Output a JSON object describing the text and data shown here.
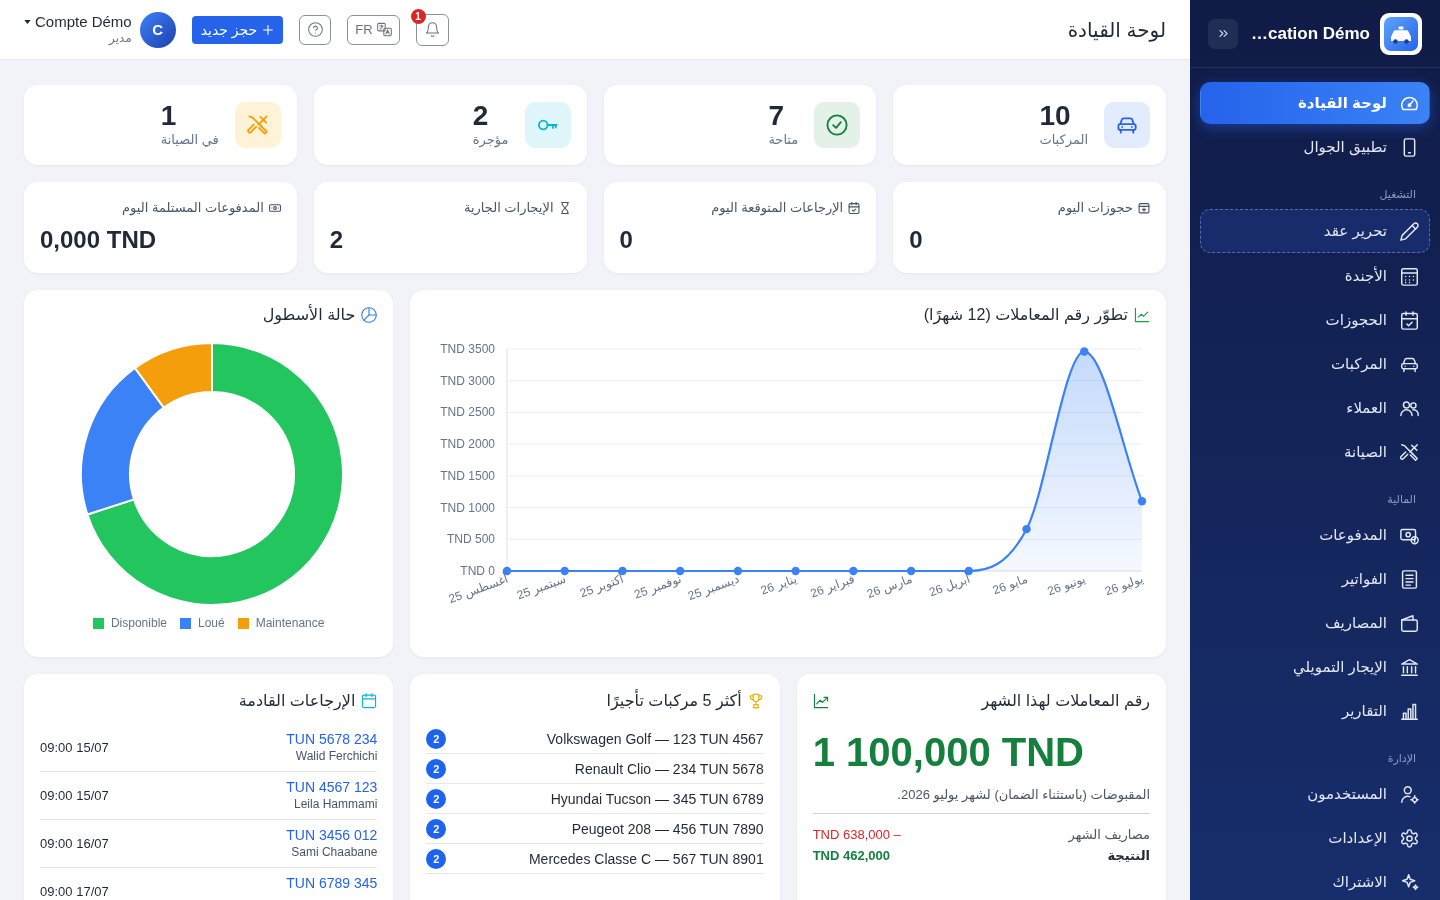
{
  "sidebar": {
    "brand": "…cation Démo",
    "sections": [
      {
        "items": [
          {
            "label": "لوحة القيادة",
            "kind": "link",
            "selected": true
          },
          {
            "label": "تطبيق الجوال",
            "kind": "link",
            "selected": false
          }
        ]
      },
      {
        "heading": "التشغيل",
        "items": [
          {
            "label": "تحرير عقد",
            "kind": "action",
            "selected": false
          },
          {
            "label": "الأجندة",
            "kind": "link",
            "selected": false
          },
          {
            "label": "الحجوزات",
            "kind": "link",
            "selected": false
          },
          {
            "label": "المركبات",
            "kind": "link",
            "selected": false
          },
          {
            "label": "العملاء",
            "kind": "link",
            "selected": false
          },
          {
            "label": "الصيانة",
            "kind": "link",
            "selected": false
          }
        ]
      },
      {
        "heading": "المالية",
        "items": [
          {
            "label": "المدفوعات",
            "kind": "link",
            "selected": false
          },
          {
            "label": "الفواتير",
            "kind": "link",
            "selected": false
          },
          {
            "label": "المصاريف",
            "kind": "link",
            "selected": false
          },
          {
            "label": "الإيجار التمويلي",
            "kind": "link",
            "selected": false
          },
          {
            "label": "التقارير",
            "kind": "link",
            "selected": false
          }
        ]
      },
      {
        "heading": "الإدارة",
        "items": [
          {
            "label": "المستخدمون",
            "kind": "link",
            "selected": false
          },
          {
            "label": "الإعدادات",
            "kind": "link",
            "selected": false
          },
          {
            "label": "الاشتراك",
            "kind": "link",
            "selected": false
          }
        ]
      }
    ]
  },
  "topbar": {
    "title": "لوحة القيادة",
    "notification_count": "1",
    "language": "FR",
    "new_booking": "حجز جديد",
    "user": {
      "initial": "C",
      "name": "Compte Démo",
      "role": "مدير"
    }
  },
  "stats": [
    {
      "label": "المركبات",
      "value": "10"
    },
    {
      "label": "متاحة",
      "value": "7"
    },
    {
      "label": "مؤجرة",
      "value": "2"
    },
    {
      "label": "في الصيانة",
      "value": "1"
    }
  ],
  "today": [
    {
      "label": "حجوزات اليوم",
      "value": "0"
    },
    {
      "label": "الإرجاعات المتوقعة اليوم",
      "value": "0"
    },
    {
      "label": "الإيجارات الجارية",
      "value": "2"
    },
    {
      "label": "المدفوعات المستلمة اليوم",
      "value": "0,000 TND"
    }
  ],
  "revenue_trend": {
    "chart_data": {
      "type": "area",
      "title": "تطوّر رقم المعاملات (12 شهرًا)",
      "categories": [
        "أغسطس 25",
        "سبتمبر 25",
        "أكتوبر 25",
        "نوفمبر 25",
        "ديسمبر 25",
        "يناير 26",
        "فبراير 26",
        "مارس 26",
        "أبريل 26",
        "مايو 26",
        "يونيو 26",
        "يوليو 26"
      ],
      "series": [
        {
          "color": "#3b82f6",
          "values": [
            0,
            0,
            0,
            0,
            0,
            0,
            0,
            0,
            0,
            660,
            3460,
            1100
          ]
        }
      ],
      "ylim": [
        0,
        3500
      ],
      "yticks": [
        {
          "value": 0,
          "label": "0 TND"
        },
        {
          "value": 500,
          "label": "500 TND"
        },
        {
          "value": 1000,
          "label": "1000 TND"
        },
        {
          "value": 1500,
          "label": "1500 TND"
        },
        {
          "value": 2000,
          "label": "2000 TND"
        },
        {
          "value": 2500,
          "label": "2500 TND"
        },
        {
          "value": 3000,
          "label": "3000 TND"
        },
        {
          "value": 3500,
          "label": "3500 TND"
        }
      ],
      "grid": true
    }
  },
  "fleet_status": {
    "chart_data": {
      "type": "donut",
      "title": "حالة الأسطول",
      "categories": [
        "Disponible",
        "Loué",
        "Maintenance"
      ],
      "values": [
        70,
        20,
        10
      ],
      "legend": "bottom"
    }
  },
  "month_revenue": {
    "title": "رقم المعاملات لهذا الشهر",
    "amount": "1 100,000 TND",
    "note": "المقبوضات (باستثناء الضمان) لشهر يوليو 2026.",
    "rows": [
      {
        "kind": "expense",
        "label": "مصاريف الشهر",
        "value": "TND 638,000 –"
      },
      {
        "kind": "result",
        "label": "النتيجة",
        "value": "TND 462,000"
      }
    ]
  },
  "top_vehicles": {
    "title": "أكثر 5 مركبات تأجيرًا",
    "rows": [
      {
        "vehicle": "Volkswagen Golf — 123 TUN 4567",
        "count": "2"
      },
      {
        "vehicle": "Renault Clio — 234 TUN 5678",
        "count": "2"
      },
      {
        "vehicle": "Hyundai Tucson — 345 TUN 6789",
        "count": "2"
      },
      {
        "vehicle": "Peugeot 208 — 456 TUN 7890",
        "count": "2"
      },
      {
        "vehicle": "Mercedes Classe C — 567 TUN 8901",
        "count": "2"
      }
    ]
  },
  "upcoming_returns": {
    "title": "الإرجاعات القادمة",
    "rows": [
      {
        "plate": "234 TUN 5678",
        "customer": "Walid Ferchichi",
        "time": "15/07 09:00"
      },
      {
        "plate": "123 TUN 4567",
        "customer": "Leila Hammami",
        "time": "15/07 09:00"
      },
      {
        "plate": "012 TUN 3456",
        "customer": "Sami Chaabane",
        "time": "16/07 09:00"
      },
      {
        "plate": "345 TUN 6789",
        "time": "17/07 09:00"
      }
    ]
  }
}
